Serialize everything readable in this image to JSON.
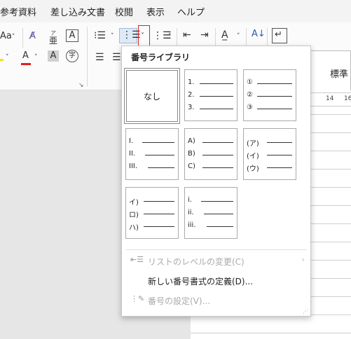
{
  "menu": {
    "tabs": [
      "参考資料",
      "差し込み文書",
      "校閲",
      "表示",
      "ヘルプ"
    ]
  },
  "ribbon": {
    "font_size_label": "Aa",
    "font_color_label": "A",
    "ruby_label": "亜",
    "ruby_top": "ア",
    "char_border_label": "A",
    "char_shade_label": "A",
    "enclose_label": "字",
    "style_label": "標準",
    "colors": {
      "highlight": "#f6e21b",
      "font_color": "#e02020",
      "focus_box": "#e0201f"
    }
  },
  "ruler": {
    "ticks": [
      "14",
      "16"
    ]
  },
  "numbering_dropdown": {
    "title": "番号ライブラリ",
    "none_label": "なし",
    "formats": [
      {
        "markers": [
          "1.",
          "2.",
          "3."
        ]
      },
      {
        "markers": [
          "①",
          "②",
          "③"
        ]
      },
      {
        "markers": [
          "I.",
          "II.",
          "III."
        ]
      },
      {
        "markers": [
          "A)",
          "B)",
          "C)"
        ]
      },
      {
        "markers": [
          "(ア)",
          "(イ)",
          "(ウ)"
        ]
      },
      {
        "markers": [
          "イ)",
          "ロ)",
          "ハ)"
        ]
      },
      {
        "markers": [
          "i.",
          "ii.",
          "iii."
        ]
      }
    ],
    "menu_items": [
      {
        "label": "リストのレベルの変更(C)",
        "disabled": true,
        "icon": "list-level-icon",
        "submenu": true
      },
      {
        "label": "新しい番号書式の定義(D)...",
        "disabled": false,
        "icon": "",
        "submenu": false
      },
      {
        "label": "番号の設定(V)...",
        "disabled": true,
        "icon": "numbering-value-icon",
        "submenu": false
      }
    ]
  }
}
